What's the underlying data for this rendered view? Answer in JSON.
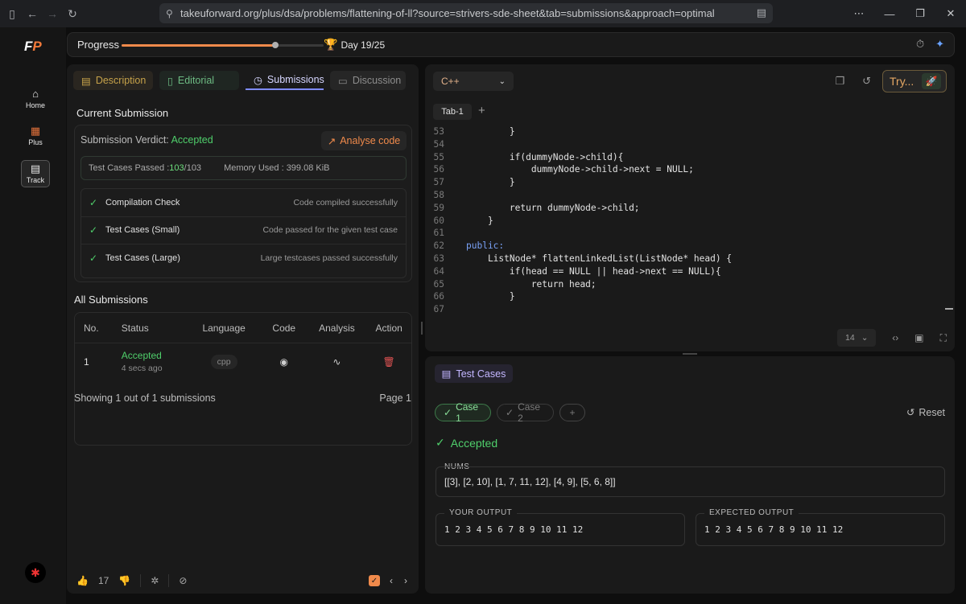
{
  "browser": {
    "url": "takeuforward.org/plus/dsa/problems/flattening-of-ll?source=strivers-sde-sheet&tab=submissions&approach=optimal"
  },
  "sidebar": {
    "logo": "F",
    "items": [
      {
        "label": "Home",
        "icon": "home-icon"
      },
      {
        "label": "Plus",
        "icon": "grid-icon"
      },
      {
        "label": "Track",
        "icon": "document-icon"
      }
    ]
  },
  "progress": {
    "label": "Progress",
    "day_text": "Day 19/25",
    "fraction": 0.76
  },
  "tabs": {
    "description": "Description",
    "editorial": "Editorial",
    "submissions": "Submissions",
    "discussion": "Discussion"
  },
  "current": {
    "title": "Current Submission",
    "verdict_label": "Submission Verdict: ",
    "verdict": "Accepted",
    "analyse": "Analyse code",
    "tests_label": "Test Cases Passed : ",
    "tests_passed": "103",
    "tests_total": "/103",
    "memory": "Memory Used : 399.08 KiB",
    "checks": [
      {
        "name": "Compilation Check",
        "msg": "Code compiled successfully"
      },
      {
        "name": "Test Cases (Small)",
        "msg": "Code passed for the given test case"
      },
      {
        "name": "Test Cases (Large)",
        "msg": "Large testcases passed successfully"
      }
    ]
  },
  "all_submissions": {
    "title": "All Submissions",
    "headers": [
      "No.",
      "Status",
      "Language",
      "Code",
      "Analysis",
      "Action"
    ],
    "rows": [
      {
        "no": "1",
        "status": "Accepted",
        "time": "4 secs ago",
        "language": "cpp"
      }
    ],
    "showing": "Showing 1 out of 1 submissions",
    "page": "Page 1"
  },
  "left_footer": {
    "likes": "17"
  },
  "editor": {
    "language": "C++",
    "try_label": "Try...",
    "file_tab": "Tab-1",
    "font_size": "14",
    "lines": [
      {
        "n": "53",
        "code": "        }"
      },
      {
        "n": "54",
        "code": ""
      },
      {
        "n": "55",
        "code": "        if(dummyNode->child){"
      },
      {
        "n": "56",
        "code": "            dummyNode->child->next = NULL;"
      },
      {
        "n": "57",
        "code": "        }"
      },
      {
        "n": "58",
        "code": ""
      },
      {
        "n": "59",
        "code": "        return dummyNode->child;"
      },
      {
        "n": "60",
        "code": "    }"
      },
      {
        "n": "61",
        "code": ""
      },
      {
        "n": "62",
        "code": "public:"
      },
      {
        "n": "63",
        "code": "    ListNode* flattenLinkedList(ListNode* head) {"
      },
      {
        "n": "64",
        "code": "        if(head == NULL || head->next == NULL){"
      },
      {
        "n": "65",
        "code": "            return head;"
      },
      {
        "n": "66",
        "code": "        }"
      },
      {
        "n": "67",
        "code": ""
      }
    ]
  },
  "testcases": {
    "title": "Test Cases",
    "case1": "Case 1",
    "case2": "Case 2",
    "reset": "Reset",
    "result": "Accepted",
    "nums_label": "NUMS",
    "nums_value": "[[3], [2, 10], [1, 7, 11, 12], [4, 9], [5, 6, 8]]",
    "your_output_label": "YOUR OUTPUT",
    "your_output": "1 2 3 4 5 6 7 8 9 10 11 12",
    "expected_label": "EXPECTED OUTPUT",
    "expected": "1 2 3 4 5 6 7 8 9 10 11 12"
  }
}
